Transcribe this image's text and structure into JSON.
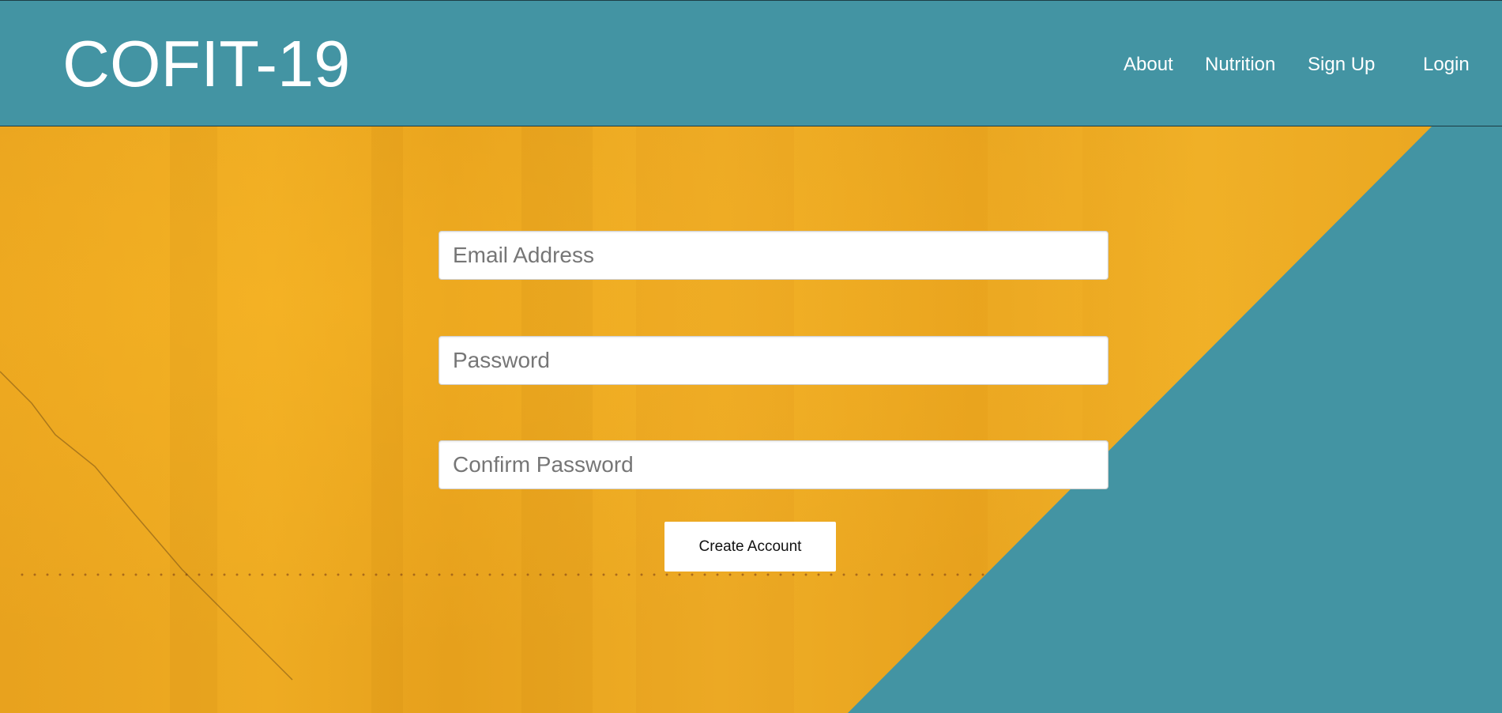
{
  "header": {
    "brand": "COFIT-19",
    "nav": {
      "about": "About",
      "nutrition": "Nutrition",
      "signup": "Sign Up",
      "login": "Login"
    }
  },
  "form": {
    "email_placeholder": "Email Address",
    "password_placeholder": "Password",
    "confirm_placeholder": "Confirm Password",
    "submit_label": "Create Account"
  },
  "colors": {
    "header_bg": "#4394a3",
    "hero_yellow": "#e9a51f",
    "teal_triangle": "#4394a3"
  }
}
